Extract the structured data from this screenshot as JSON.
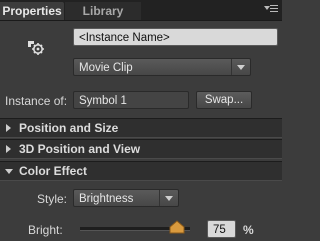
{
  "tabs": [
    {
      "label": "Properties",
      "active": true
    },
    {
      "label": "Library",
      "active": false
    }
  ],
  "panel_menu_icon": "panel-menu-icon",
  "symbol_icon": "movie-clip-symbol-icon",
  "instance_name": {
    "placeholder": "<Instance Name>"
  },
  "symbol_type": {
    "selected": "Movie Clip"
  },
  "instance_of": {
    "label": "Instance of:",
    "value": "Symbol 1",
    "swap_label": "Swap..."
  },
  "sections": [
    {
      "title": "Position and Size",
      "expanded": false
    },
    {
      "title": "3D Position and View",
      "expanded": false
    },
    {
      "title": "Color Effect",
      "expanded": true
    }
  ],
  "color_effect": {
    "style_label": "Style:",
    "style_value": "Brightness",
    "bright_label": "Bright:",
    "bright_value": "75",
    "bright_unit": "%",
    "slider_fraction": 0.875
  },
  "colors": {
    "panel_bg": "#3c3c3c",
    "section_bg": "#2f2f2f",
    "slider_thumb": "#e0a040"
  }
}
